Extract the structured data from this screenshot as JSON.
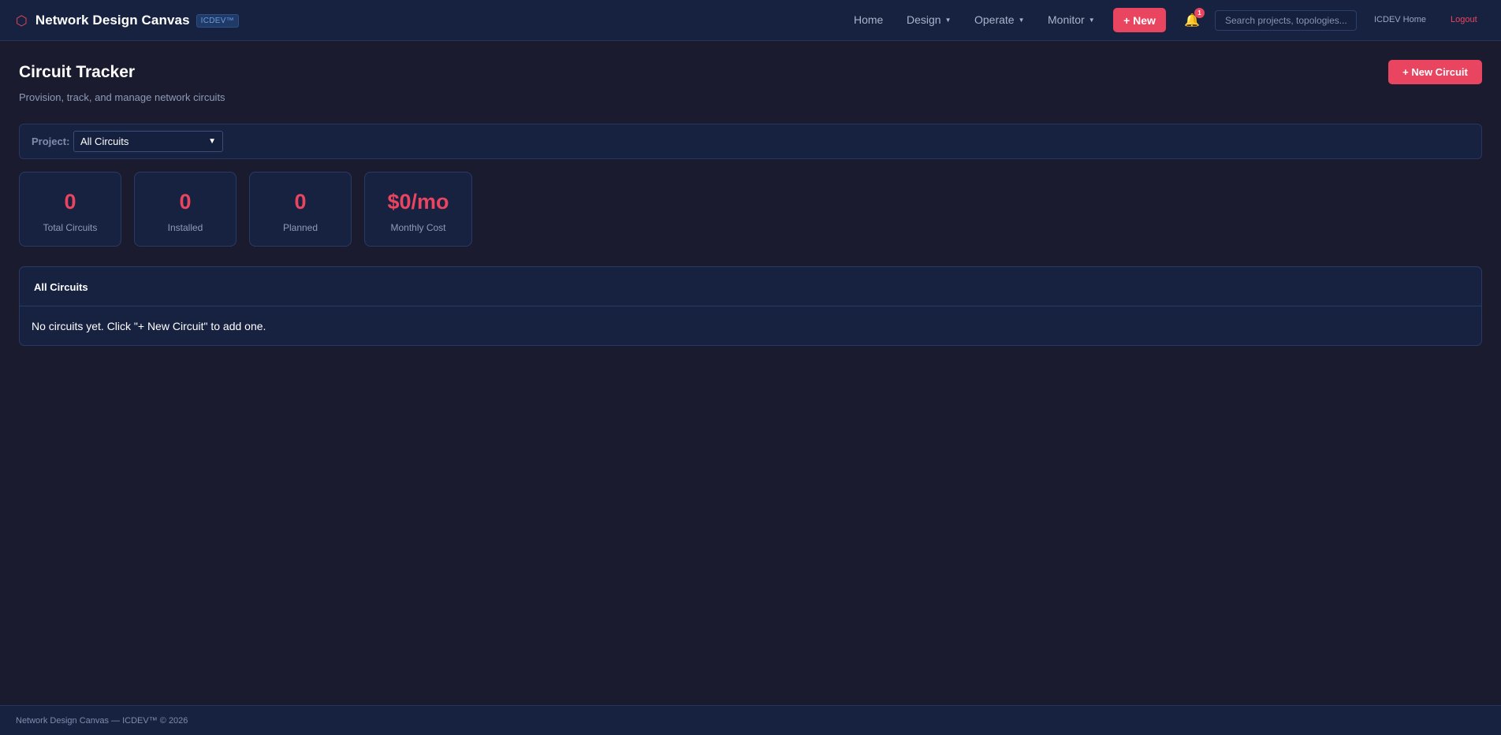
{
  "brand": {
    "icon": "hexagon-icon",
    "title": "Network Design Canvas",
    "badge": "ICDEV™"
  },
  "nav": {
    "home": "Home",
    "design": "Design",
    "operate": "Operate",
    "monitor": "Monitor",
    "new_button": "+ New",
    "notification_count": "1",
    "search_placeholder": "Search projects, topologies...",
    "icdev_home": "ICDEV Home",
    "logout": "Logout"
  },
  "header": {
    "title": "Circuit Tracker",
    "subtitle": "Provision, track, and manage network circuits",
    "new_circuit_button": "+ New Circuit"
  },
  "filter": {
    "label": "Project:",
    "selected": "All Circuits"
  },
  "stats": [
    {
      "value": "0",
      "label": "Total Circuits"
    },
    {
      "value": "0",
      "label": "Installed"
    },
    {
      "value": "0",
      "label": "Planned"
    },
    {
      "value": "$0/mo",
      "label": "Monthly Cost"
    }
  ],
  "panel": {
    "title": "All Circuits",
    "empty_message": "No circuits yet. Click \"+ New Circuit\" to add one."
  },
  "footer": {
    "text": "Network Design Canvas — ICDEV™ © 2026"
  },
  "colors": {
    "accent": "#e94560",
    "background": "#1a1b2e",
    "surface": "#172241",
    "bell": "#f5b922"
  }
}
